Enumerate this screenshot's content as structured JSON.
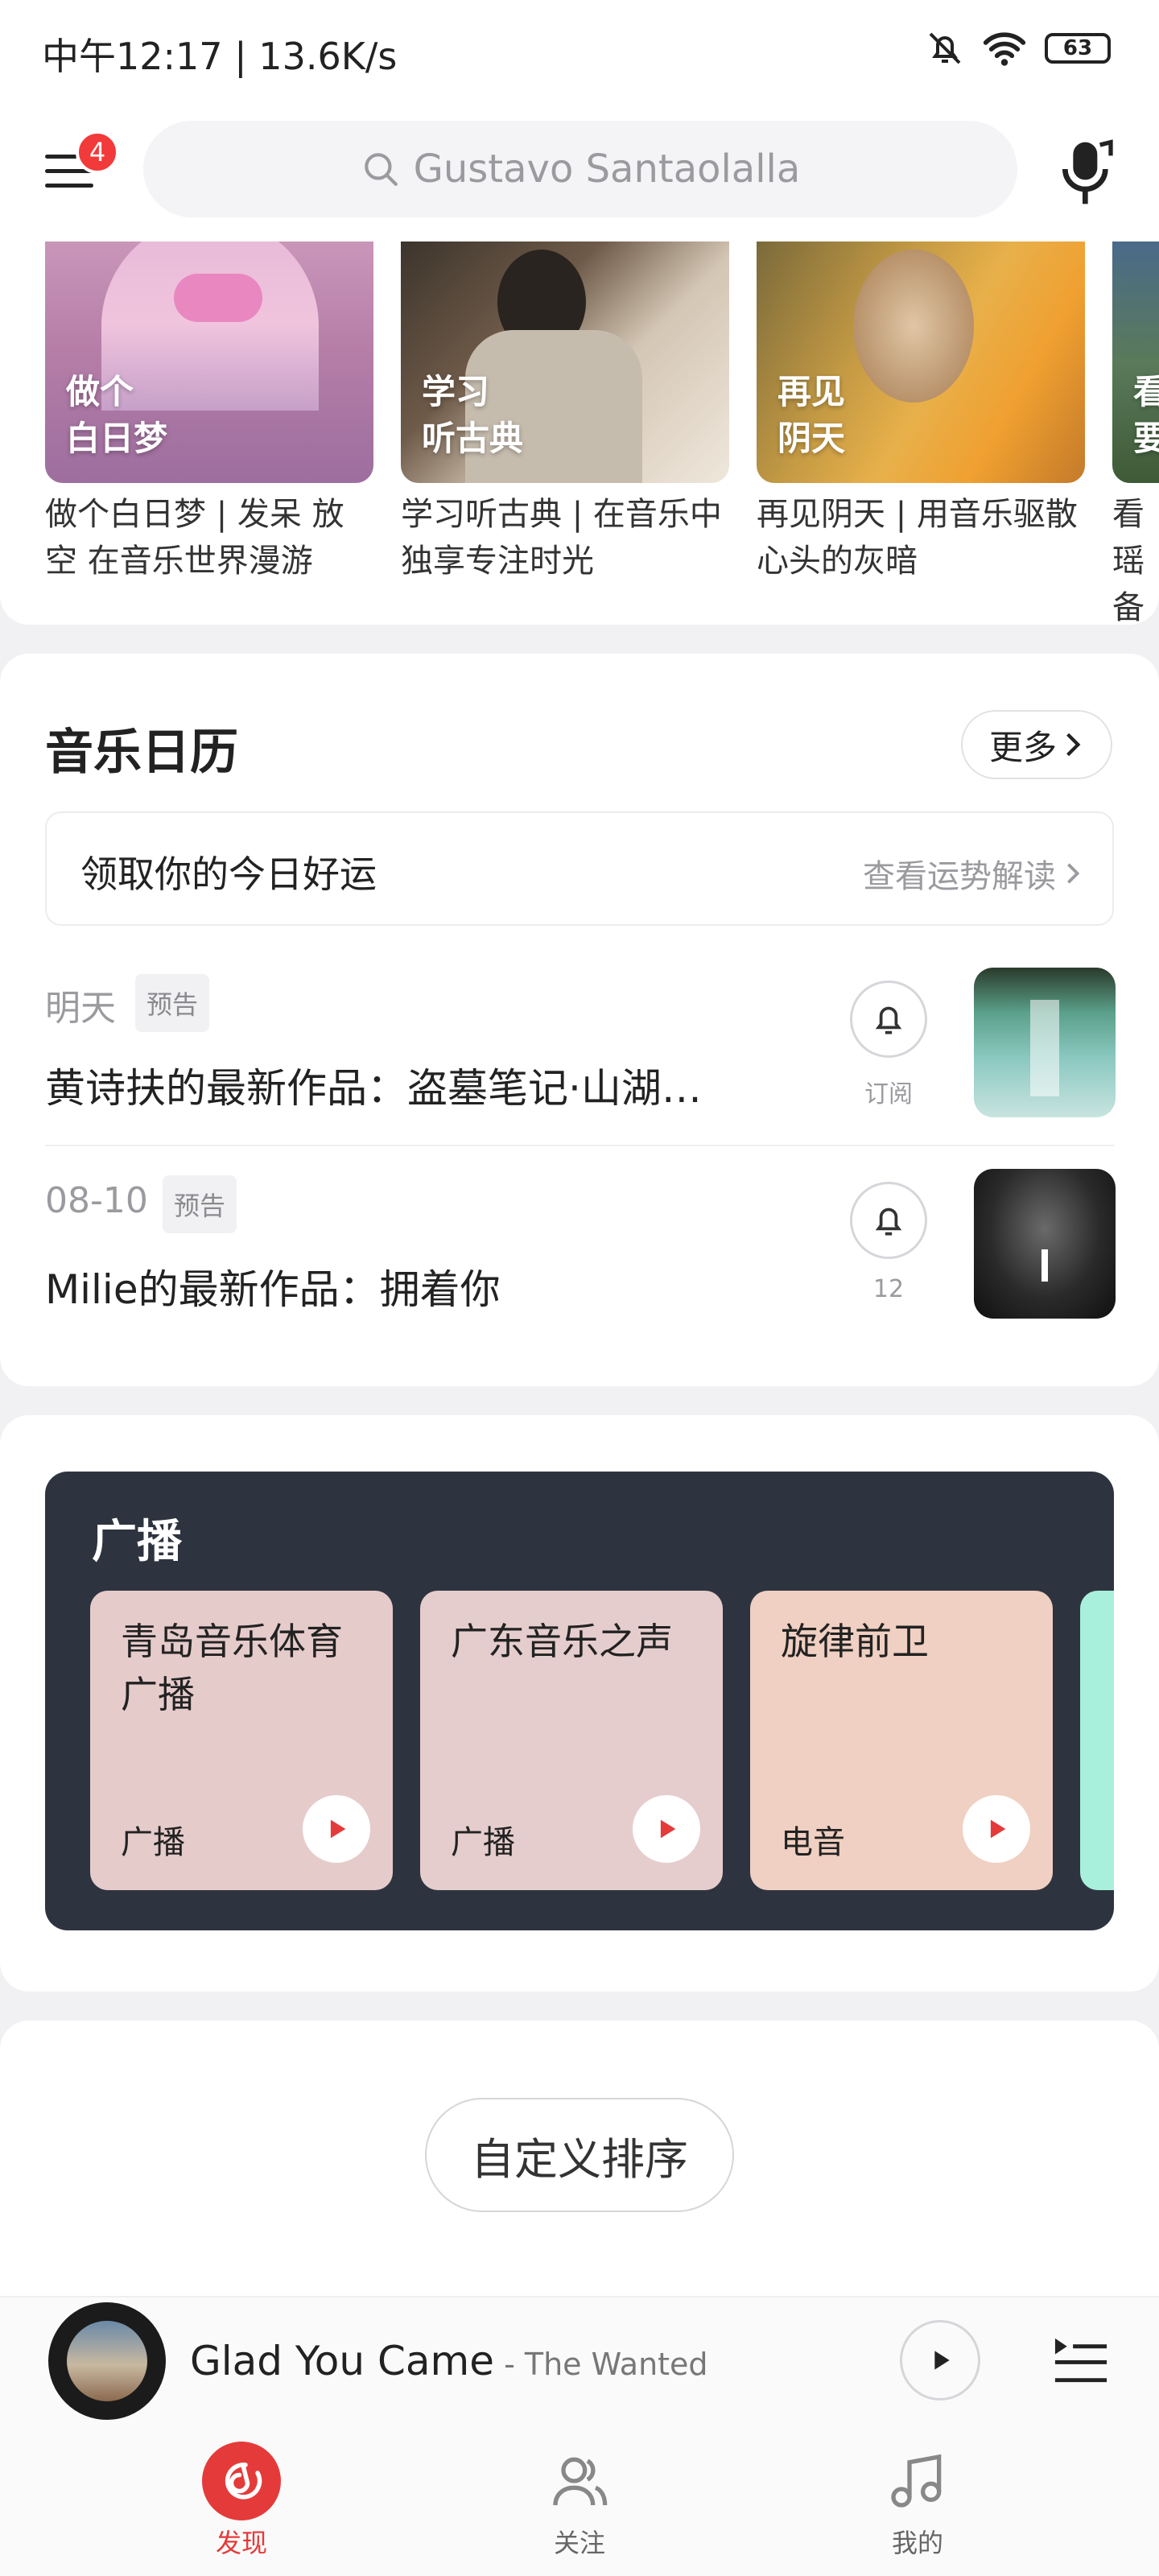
{
  "status_bar": {
    "time_speed": "中午12:17 | 13.6K/s",
    "battery": "63"
  },
  "header": {
    "menu_badge": "4",
    "search_placeholder": "Gustavo Santaolalla"
  },
  "playlists": [
    {
      "overlay_line1": "做个",
      "overlay_line2": "白日梦",
      "desc": "做个白日梦 | 发呆 放空 在音乐世界漫游"
    },
    {
      "overlay_line1": "学习",
      "overlay_line2": "听古典",
      "desc": "学习听古典 | 在音乐中独享专注时光"
    },
    {
      "overlay_line1": "再见",
      "overlay_line2": "阴天",
      "desc": "再见阴天 | 用音乐驱散心头的灰暗"
    },
    {
      "overlay_line1": "看",
      "overlay_line2": "要",
      "desc": "看瑶备起"
    }
  ],
  "calendar": {
    "title": "音乐日历",
    "more_label": "更多",
    "fortune_label": "领取你的今日好运",
    "fortune_link": "查看运势解读",
    "events": [
      {
        "date": "明天",
        "tag": "预告",
        "title": "黄诗扶的最新作品：盗墓笔记·山湖…",
        "bell_label": "订阅"
      },
      {
        "date": "08-10",
        "tag": "预告",
        "title": "Milie的最新作品：拥着你",
        "bell_label": "12"
      }
    ]
  },
  "radio": {
    "title": "广播",
    "stations": [
      {
        "name": "青岛音乐体育广播",
        "category": "广播",
        "color": "#e6cbcb"
      },
      {
        "name": "广东音乐之声",
        "category": "广播",
        "color": "#e6cdcd"
      },
      {
        "name": "旋律前卫",
        "category": "电音",
        "color": "#f0d0c2"
      }
    ]
  },
  "custom_sort_label": "自定义排序",
  "player": {
    "song": "Glad You Came",
    "separator": " - ",
    "artist": "The Wanted"
  },
  "nav": [
    {
      "label": "发现",
      "icon": "discover-icon",
      "active": true
    },
    {
      "label": "关注",
      "icon": "follow-icon",
      "active": false
    },
    {
      "label": "我的",
      "icon": "my-music-icon",
      "active": false
    }
  ],
  "colors": {
    "accent": "#e53a3a",
    "radio_bg": "#2e343f"
  }
}
